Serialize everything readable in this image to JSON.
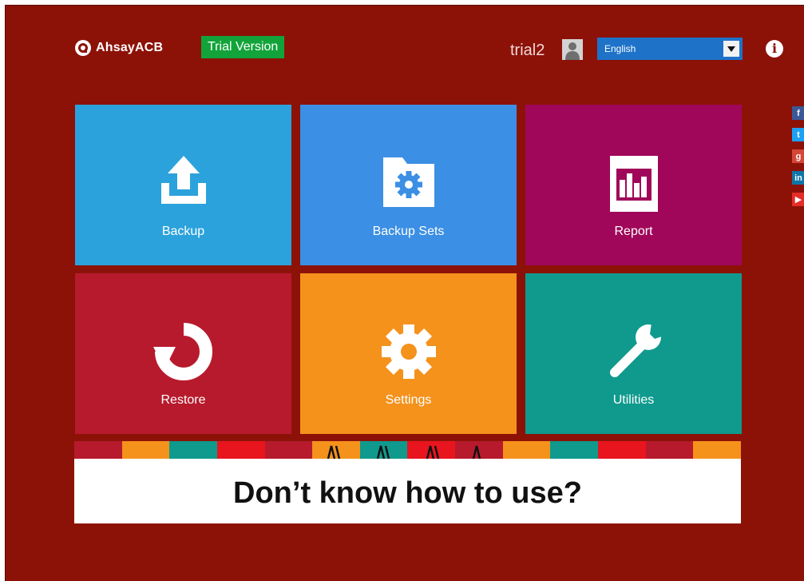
{
  "header": {
    "logo_text": "AhsayACB",
    "trial_label": "Trial Version",
    "username": "trial2",
    "language": {
      "selected": "English"
    }
  },
  "tiles": [
    {
      "label": "Backup",
      "color": "#2ba2dc",
      "icon": "upload-icon"
    },
    {
      "label": "Backup Sets",
      "color": "#3b8fe4",
      "icon": "folder-gear-icon"
    },
    {
      "label": "Report",
      "color": "#a0075a",
      "icon": "bar-chart-icon"
    },
    {
      "label": "Restore",
      "color": "#b71a2c",
      "icon": "restore-icon"
    },
    {
      "label": "Settings",
      "color": "#f4921c",
      "icon": "gear-icon"
    },
    {
      "label": "Utilities",
      "color": "#0f9a8d",
      "icon": "wrench-icon"
    }
  ],
  "social": [
    "facebook-icon",
    "twitter-icon",
    "google-plus-icon",
    "linkedin-icon",
    "youtube-icon"
  ],
  "banner": {
    "text": "Don’t know how to use?"
  },
  "colors": {
    "background": "#8c1208",
    "trial_badge": "#12a43a",
    "language_select": "#1e73c9"
  }
}
